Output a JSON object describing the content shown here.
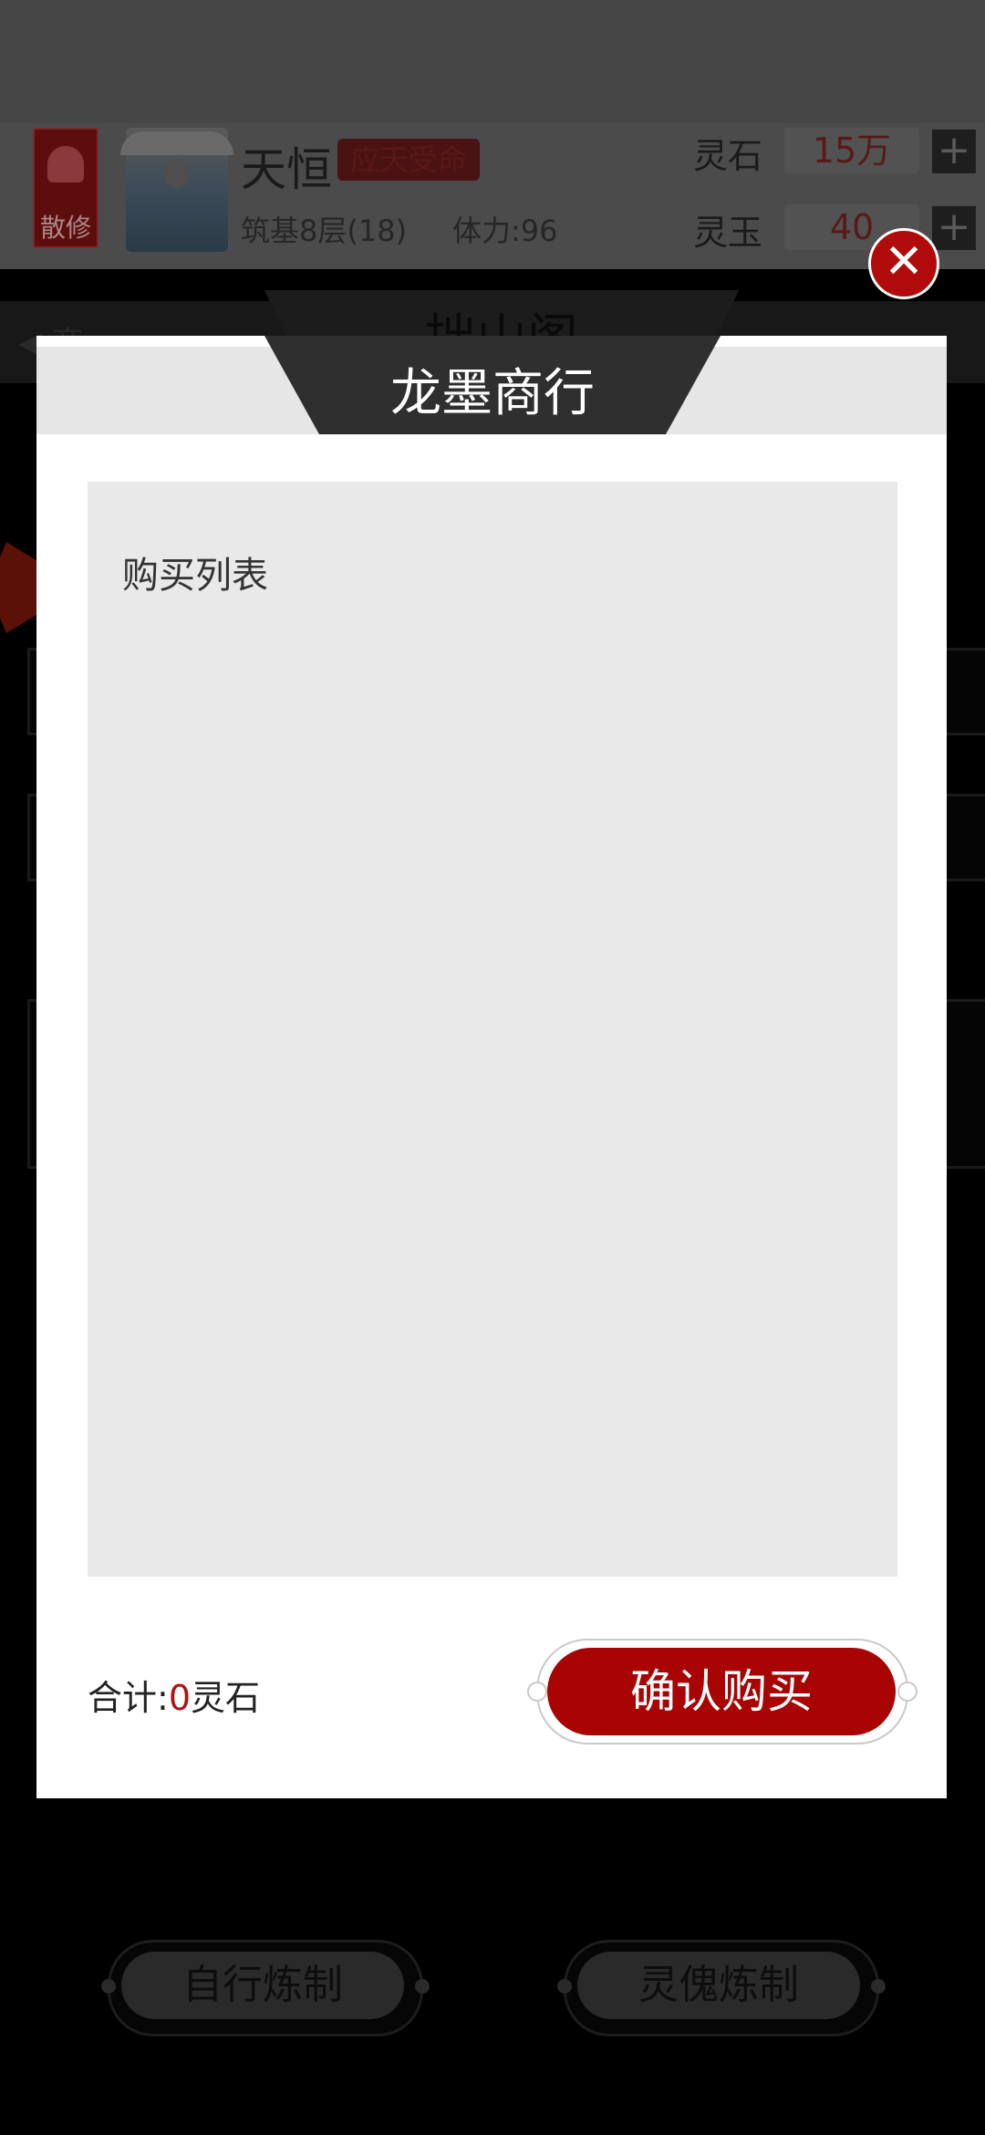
{
  "player": {
    "sect_badge": "散修",
    "name": "天恒",
    "title": "应天受命",
    "realm": "筑基8层(18)",
    "stamina": "体力:96"
  },
  "currencies": [
    {
      "label": "灵石",
      "value": "15万",
      "add_icon": "plus-icon"
    },
    {
      "label": "灵玉",
      "value": "40",
      "add_icon": "plus-icon"
    }
  ],
  "page": {
    "back_label": "◀ 商",
    "title": "拙山阁"
  },
  "bottom_buttons": {
    "self_refine": "自行炼制",
    "puppet_refine": "灵傀炼制"
  },
  "modal": {
    "title": "龙墨商行",
    "list_heading": "购买列表",
    "total_prefix": "合计:",
    "total_value": "0",
    "total_unit": "灵石",
    "confirm_label": "确认购买",
    "close_icon": "close-icon",
    "close_glyph": "✕"
  },
  "colors": {
    "accent_red": "#a80404",
    "close_red": "#b20b0b",
    "title_bar": "#2f2f2f"
  }
}
